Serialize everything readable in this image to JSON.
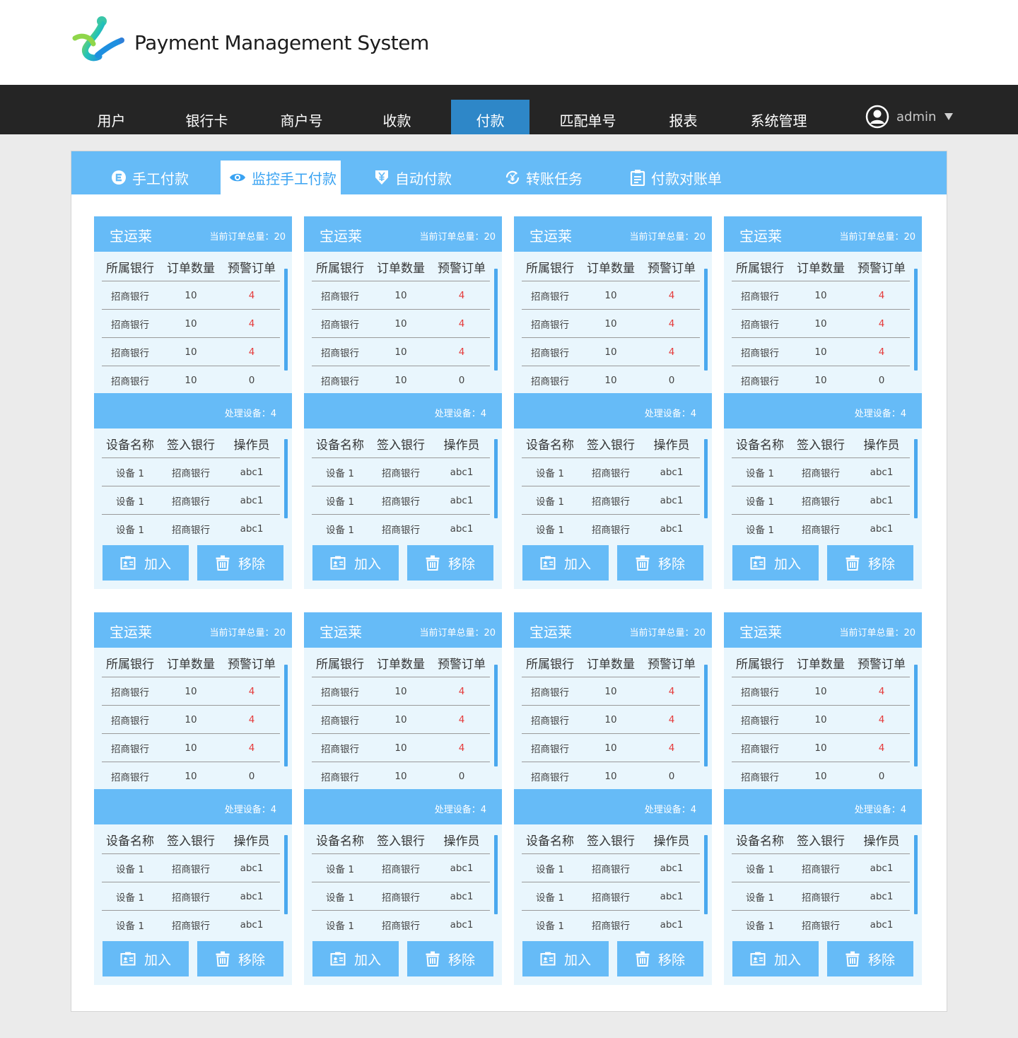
{
  "app": {
    "title": "Payment Management System"
  },
  "nav": {
    "items": [
      {
        "label": "用户"
      },
      {
        "label": "银行卡"
      },
      {
        "label": "商户号"
      },
      {
        "label": "收款"
      },
      {
        "label": "付款"
      },
      {
        "label": "匹配单号"
      },
      {
        "label": "报表"
      },
      {
        "label": "系统管理"
      }
    ],
    "active_index": 4,
    "user": "admin"
  },
  "tabs": {
    "items": [
      {
        "label": "手工付款",
        "icon": "coin-e-icon"
      },
      {
        "label": "监控手工付款",
        "icon": "eye-icon"
      },
      {
        "label": "自动付款",
        "icon": "yen-download-icon"
      },
      {
        "label": "转账任务",
        "icon": "yen-cycle-icon"
      },
      {
        "label": "付款对账单",
        "icon": "clipboard-icon"
      }
    ],
    "active_index": 1
  },
  "cards": [
    {
      "name": "宝运莱",
      "total": "当前订单总量：20",
      "order_headers": [
        "所属银行",
        "订单数量",
        "预警订单"
      ],
      "orders": [
        [
          "招商银行",
          "10",
          "4"
        ],
        [
          "招商银行",
          "10",
          "4"
        ],
        [
          "招商银行",
          "10",
          "4"
        ],
        [
          "招商银行",
          "10",
          "0"
        ]
      ],
      "device_count": "处理设备：4",
      "device_headers": [
        "设备名称",
        "签入银行",
        "操作员"
      ],
      "devices": [
        [
          "设备 1",
          "招商银行",
          "abc1"
        ],
        [
          "设备 1",
          "招商银行",
          "abc1"
        ],
        [
          "设备 1",
          "招商银行",
          "abc1"
        ]
      ],
      "add_label": "加入",
      "remove_label": "移除"
    },
    {
      "name": "宝运莱",
      "total": "当前订单总量：20",
      "order_headers": [
        "所属银行",
        "订单数量",
        "预警订单"
      ],
      "orders": [
        [
          "招商银行",
          "10",
          "4"
        ],
        [
          "招商银行",
          "10",
          "4"
        ],
        [
          "招商银行",
          "10",
          "4"
        ],
        [
          "招商银行",
          "10",
          "0"
        ]
      ],
      "device_count": "处理设备：4",
      "device_headers": [
        "设备名称",
        "签入银行",
        "操作员"
      ],
      "devices": [
        [
          "设备 1",
          "招商银行",
          "abc1"
        ],
        [
          "设备 1",
          "招商银行",
          "abc1"
        ],
        [
          "设备 1",
          "招商银行",
          "abc1"
        ]
      ],
      "add_label": "加入",
      "remove_label": "移除"
    },
    {
      "name": "宝运莱",
      "total": "当前订单总量：20",
      "order_headers": [
        "所属银行",
        "订单数量",
        "预警订单"
      ],
      "orders": [
        [
          "招商银行",
          "10",
          "4"
        ],
        [
          "招商银行",
          "10",
          "4"
        ],
        [
          "招商银行",
          "10",
          "4"
        ],
        [
          "招商银行",
          "10",
          "0"
        ]
      ],
      "device_count": "处理设备：4",
      "device_headers": [
        "设备名称",
        "签入银行",
        "操作员"
      ],
      "devices": [
        [
          "设备 1",
          "招商银行",
          "abc1"
        ],
        [
          "设备 1",
          "招商银行",
          "abc1"
        ],
        [
          "设备 1",
          "招商银行",
          "abc1"
        ]
      ],
      "add_label": "加入",
      "remove_label": "移除"
    },
    {
      "name": "宝运莱",
      "total": "当前订单总量：20",
      "order_headers": [
        "所属银行",
        "订单数量",
        "预警订单"
      ],
      "orders": [
        [
          "招商银行",
          "10",
          "4"
        ],
        [
          "招商银行",
          "10",
          "4"
        ],
        [
          "招商银行",
          "10",
          "4"
        ],
        [
          "招商银行",
          "10",
          "0"
        ]
      ],
      "device_count": "处理设备：4",
      "device_headers": [
        "设备名称",
        "签入银行",
        "操作员"
      ],
      "devices": [
        [
          "设备 1",
          "招商银行",
          "abc1"
        ],
        [
          "设备 1",
          "招商银行",
          "abc1"
        ],
        [
          "设备 1",
          "招商银行",
          "abc1"
        ]
      ],
      "add_label": "加入",
      "remove_label": "移除"
    },
    {
      "name": "宝运莱",
      "total": "当前订单总量：20",
      "order_headers": [
        "所属银行",
        "订单数量",
        "预警订单"
      ],
      "orders": [
        [
          "招商银行",
          "10",
          "4"
        ],
        [
          "招商银行",
          "10",
          "4"
        ],
        [
          "招商银行",
          "10",
          "4"
        ],
        [
          "招商银行",
          "10",
          "0"
        ]
      ],
      "device_count": "处理设备：4",
      "device_headers": [
        "设备名称",
        "签入银行",
        "操作员"
      ],
      "devices": [
        [
          "设备 1",
          "招商银行",
          "abc1"
        ],
        [
          "设备 1",
          "招商银行",
          "abc1"
        ],
        [
          "设备 1",
          "招商银行",
          "abc1"
        ]
      ],
      "add_label": "加入",
      "remove_label": "移除"
    },
    {
      "name": "宝运莱",
      "total": "当前订单总量：20",
      "order_headers": [
        "所属银行",
        "订单数量",
        "预警订单"
      ],
      "orders": [
        [
          "招商银行",
          "10",
          "4"
        ],
        [
          "招商银行",
          "10",
          "4"
        ],
        [
          "招商银行",
          "10",
          "4"
        ],
        [
          "招商银行",
          "10",
          "0"
        ]
      ],
      "device_count": "处理设备：4",
      "device_headers": [
        "设备名称",
        "签入银行",
        "操作员"
      ],
      "devices": [
        [
          "设备 1",
          "招商银行",
          "abc1"
        ],
        [
          "设备 1",
          "招商银行",
          "abc1"
        ],
        [
          "设备 1",
          "招商银行",
          "abc1"
        ]
      ],
      "add_label": "加入",
      "remove_label": "移除"
    },
    {
      "name": "宝运莱",
      "total": "当前订单总量：20",
      "order_headers": [
        "所属银行",
        "订单数量",
        "预警订单"
      ],
      "orders": [
        [
          "招商银行",
          "10",
          "4"
        ],
        [
          "招商银行",
          "10",
          "4"
        ],
        [
          "招商银行",
          "10",
          "4"
        ],
        [
          "招商银行",
          "10",
          "0"
        ]
      ],
      "device_count": "处理设备：4",
      "device_headers": [
        "设备名称",
        "签入银行",
        "操作员"
      ],
      "devices": [
        [
          "设备 1",
          "招商银行",
          "abc1"
        ],
        [
          "设备 1",
          "招商银行",
          "abc1"
        ],
        [
          "设备 1",
          "招商银行",
          "abc1"
        ]
      ],
      "add_label": "加入",
      "remove_label": "移除"
    },
    {
      "name": "宝运莱",
      "total": "当前订单总量：20",
      "order_headers": [
        "所属银行",
        "订单数量",
        "预警订单"
      ],
      "orders": [
        [
          "招商银行",
          "10",
          "4"
        ],
        [
          "招商银行",
          "10",
          "4"
        ],
        [
          "招商银行",
          "10",
          "4"
        ],
        [
          "招商银行",
          "10",
          "0"
        ]
      ],
      "device_count": "处理设备：4",
      "device_headers": [
        "设备名称",
        "签入银行",
        "操作员"
      ],
      "devices": [
        [
          "设备 1",
          "招商银行",
          "abc1"
        ],
        [
          "设备 1",
          "招商银行",
          "abc1"
        ],
        [
          "设备 1",
          "招商银行",
          "abc1"
        ]
      ],
      "add_label": "加入",
      "remove_label": "移除"
    }
  ],
  "colors": {
    "accent": "#66bbf7",
    "nav_active": "#2e87c8",
    "warning": "#e53a3a",
    "card_bg": "#e9f6fd"
  }
}
